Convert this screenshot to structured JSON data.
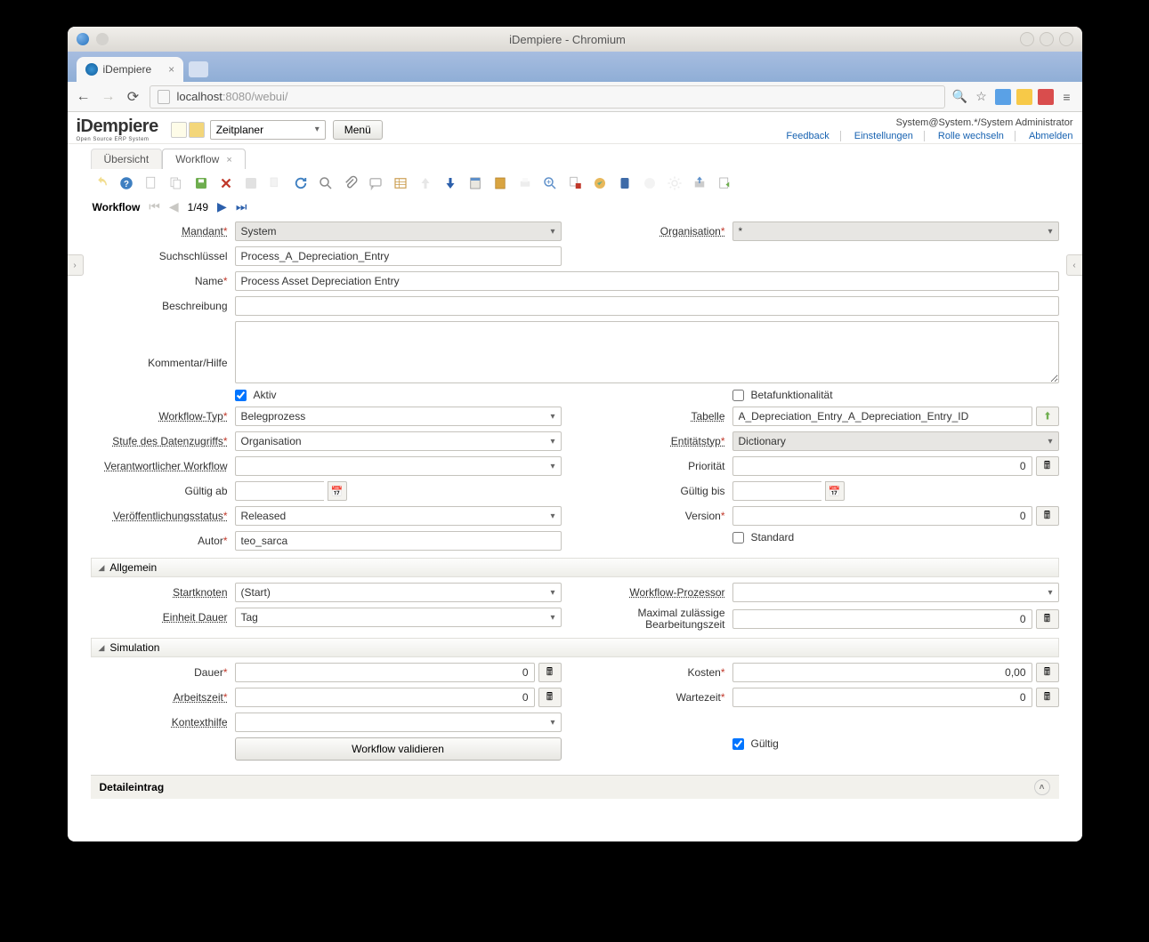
{
  "window_title": "iDempiere - Chromium",
  "browser_tab": "iDempiere",
  "url_host": "localhost",
  "url_port_path": ":8080/webui/",
  "logo": "iDempiere",
  "logo_sub": "Open Source ERP System",
  "quicklaunch": "Zeitplaner",
  "menu_btn": "Menü",
  "user_context": "System@System.*/System Administrator",
  "links": {
    "feedback": "Feedback",
    "settings": "Einstellungen",
    "changerole": "Rolle wechseln",
    "logout": "Abmelden"
  },
  "tabs": {
    "overview": "Übersicht",
    "workflow": "Workflow"
  },
  "recnav": {
    "title": "Workflow",
    "pos": "1/49"
  },
  "labels": {
    "mandant": "Mandant",
    "organisation": "Organisation",
    "searchkey": "Suchschlüssel",
    "name": "Name",
    "description": "Beschreibung",
    "help": "Kommentar/Hilfe",
    "active": "Aktiv",
    "beta": "Betafunktionalität",
    "wftype": "Workflow-Typ",
    "table": "Tabelle",
    "accesslevel": "Stufe des Datenzugriffs",
    "entitytype": "Entitätstyp",
    "responsible": "Verantwortlicher Workflow",
    "priority": "Priorität",
    "validfrom": "Gültig ab",
    "validto": "Gültig bis",
    "pubstatus": "Veröffentlichungsstatus",
    "version": "Version",
    "author": "Autor",
    "default": "Standard",
    "sec_general": "Allgemein",
    "startnode": "Startknoten",
    "wfprocessor": "Workflow-Prozessor",
    "durationunit": "Einheit Dauer",
    "durationlimit": "Maximal zulässige Bearbeitungszeit",
    "sec_sim": "Simulation",
    "duration": "Dauer",
    "cost": "Kosten",
    "worktime": "Arbeitszeit",
    "waittime": "Wartezeit",
    "ctxhelp": "Kontexthilfe",
    "validate_btn": "Workflow validieren",
    "valid": "Gültig",
    "detail": "Detaileintrag"
  },
  "values": {
    "mandant": "System",
    "organisation": "*",
    "searchkey": "Process_A_Depreciation_Entry",
    "name": "Process Asset Depreciation Entry",
    "description": "",
    "help": "",
    "active": true,
    "beta": false,
    "wftype": "Belegprozess",
    "table": "A_Depreciation_Entry_A_Depreciation_Entry_ID",
    "accesslevel": "Organisation",
    "entitytype": "Dictionary",
    "responsible": "",
    "priority": "0",
    "validfrom": "",
    "validto": "",
    "pubstatus": "Released",
    "version": "0",
    "author": "teo_sarca",
    "default": false,
    "startnode": "(Start)",
    "wfprocessor": "",
    "durationunit": "Tag",
    "durationlimit": "0",
    "duration": "0",
    "cost": "0,00",
    "worktime": "0",
    "waittime": "0",
    "ctxhelp": "",
    "valid": true
  }
}
